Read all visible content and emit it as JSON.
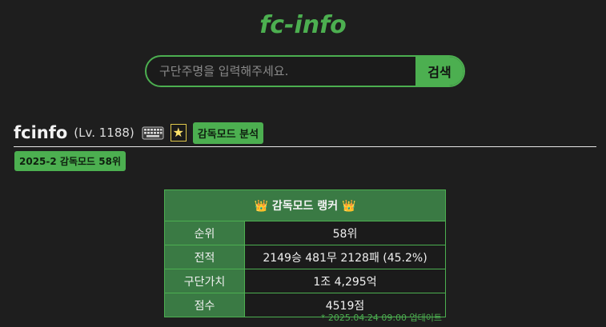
{
  "logo": "fc-info",
  "search": {
    "placeholder": "구단주명을 입력해주세요.",
    "button_label": "검색"
  },
  "profile": {
    "name": "fcinfo",
    "level": "(Lv. 1188)",
    "keyboard_icon": "keyboard-icon",
    "star_icon": "star-icon",
    "star_glyph": "★",
    "analysis_button": "감독모드 분석",
    "season_rank": "2025-2 감독모드 58위"
  },
  "ranker_table": {
    "title": "👑 감독모드 랭커 👑",
    "rows": [
      {
        "label": "순위",
        "value": "58위"
      },
      {
        "label": "전적",
        "value": "2149승 481무 2128패 (45.2%)"
      },
      {
        "label": "구단가치",
        "value": "1조 4,295억"
      },
      {
        "label": "점수",
        "value": "4519점"
      }
    ],
    "updated": "* 2025.04.24 09:00 업데이트"
  },
  "colors": {
    "accent": "#4caf50",
    "background": "#1e1e1e",
    "table_header": "#3a7a44"
  }
}
